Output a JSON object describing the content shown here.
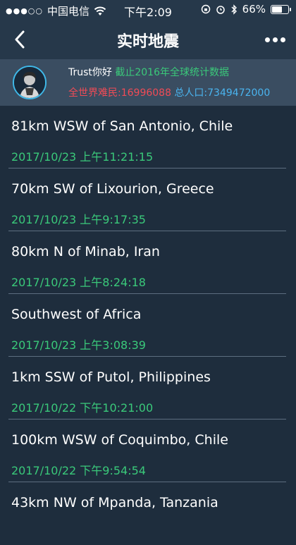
{
  "status": {
    "carrier": "中国电信",
    "time": "下午2:09",
    "battery_percent": "66%",
    "battery_level": 0.66
  },
  "nav": {
    "title": "实时地震"
  },
  "user": {
    "greeting": "Trust你好",
    "stats_caption": "截止2016年全球统计数据",
    "refugees": "全世界难民:16996088",
    "population": "总人口:7349472000"
  },
  "quakes": [
    {
      "place": "81km WSW of San Antonio, Chile",
      "time": "2017/10/23 上午11:21:15"
    },
    {
      "place": "70km SW of Lixourion, Greece",
      "time": "2017/10/23 上午9:17:35"
    },
    {
      "place": "80km N of Minab, Iran",
      "time": "2017/10/23 上午8:24:18"
    },
    {
      "place": "Southwest of Africa",
      "time": "2017/10/23 上午3:08:39"
    },
    {
      "place": "1km SSW of Putol, Philippines",
      "time": "2017/10/22 下午10:21:00"
    },
    {
      "place": "100km WSW of Coquimbo, Chile",
      "time": "2017/10/22 下午9:54:54"
    },
    {
      "place": "43km NW of Mpanda, Tanzania",
      "time": ""
    }
  ],
  "icons": {
    "back": "chevron-left-icon",
    "more": "more-dots-icon",
    "wifi": "wifi-icon",
    "lock": "rotation-lock-icon",
    "alarm": "alarm-icon",
    "bluetooth": "bluetooth-icon"
  },
  "colors": {
    "background": "#1e2d3d",
    "header": "#26384a",
    "card": "#3a4d61",
    "green": "#3ac97a",
    "red": "#f04b56",
    "blue": "#4ab4ef"
  }
}
